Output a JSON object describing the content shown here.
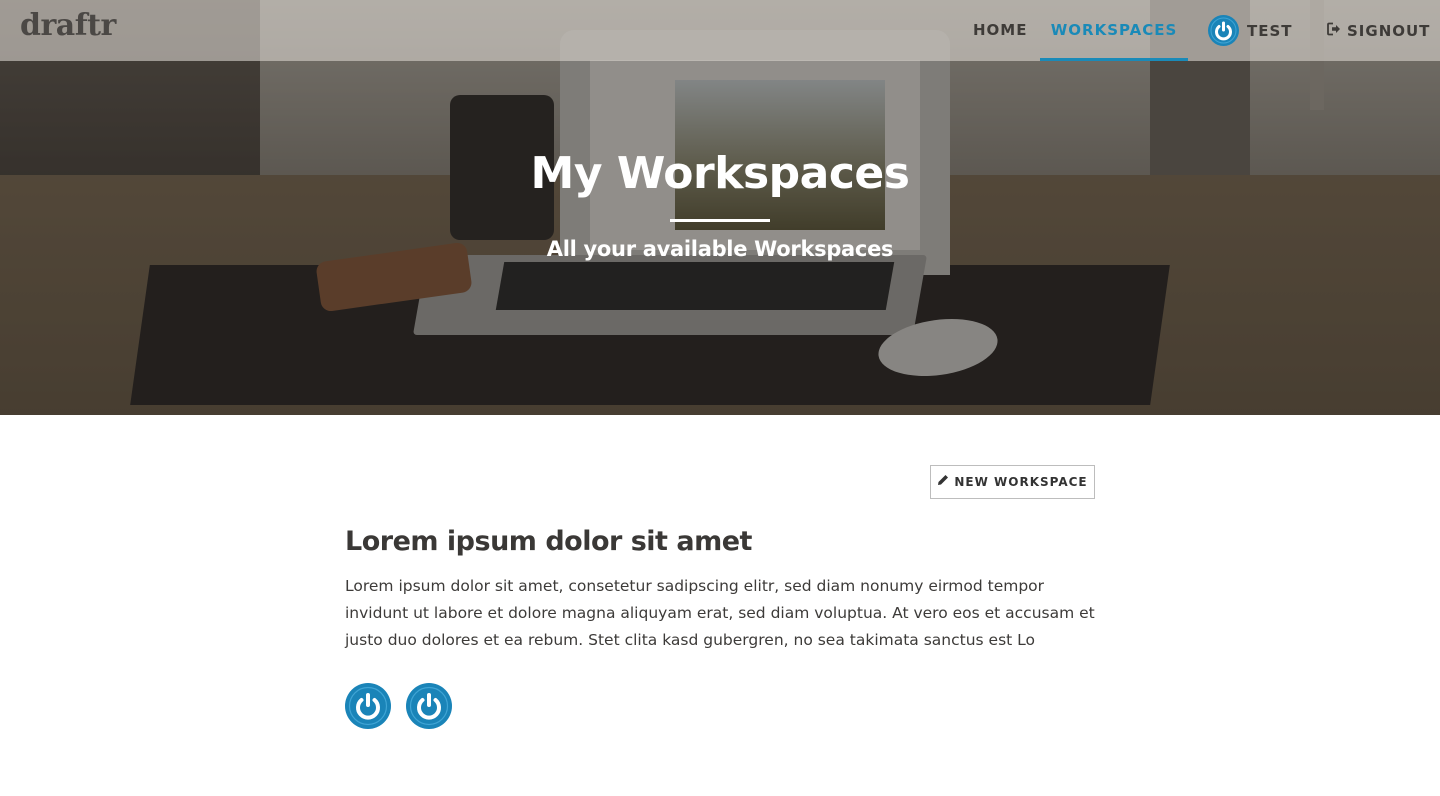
{
  "navbar": {
    "logo": "draftr",
    "items": [
      {
        "label": "HOME",
        "active": false
      },
      {
        "label": "WORKSPACES",
        "active": true
      }
    ],
    "user": {
      "label": "TEST",
      "avatar_icon": "power-icon"
    },
    "signout": {
      "label": "SIGNOUT",
      "icon": "signout-icon"
    }
  },
  "hero": {
    "title": "My Workspaces",
    "subtitle": "All your available Workspaces"
  },
  "actions": {
    "new_workspace_label": "NEW WORKSPACE",
    "new_workspace_icon": "pencil-icon"
  },
  "workspace": {
    "title": "Lorem ipsum dolor sit amet",
    "description": "Lorem ipsum dolor sit amet, consetetur sadipscing elitr, sed diam nonumy eirmod tempor invidunt ut labore et dolore magna aliquyam erat, sed diam voluptua. At vero eos et accusam et justo duo dolores et ea rebum. Stet clita kasd gubergren, no sea takimata sanctus est Lo",
    "members": [
      {
        "avatar_icon": "power-icon"
      },
      {
        "avatar_icon": "power-icon"
      }
    ]
  },
  "colors": {
    "accent": "#1a8ab8",
    "avatar": "#1a84b8",
    "text": "#3a3836"
  }
}
